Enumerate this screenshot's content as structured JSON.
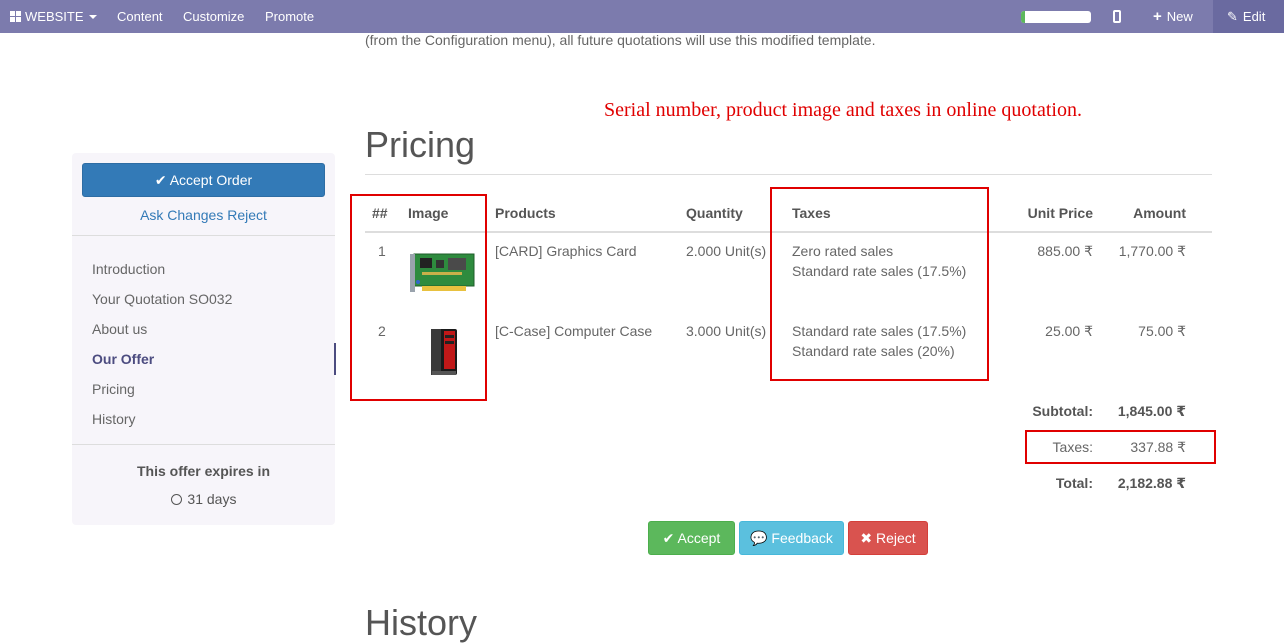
{
  "topbar": {
    "website": "WEBSITE",
    "content": "Content",
    "customize": "Customize",
    "promote": "Promote",
    "new": "New",
    "edit": "Edit"
  },
  "intro_text": "(from the Configuration menu), all future quotations will use this modified template.",
  "annotation": "Serial number, product image and taxes in online quotation.",
  "sidebar": {
    "accept_order": "Accept Order",
    "ask_changes": "Ask Changes",
    "reject": "Reject",
    "nav": [
      "Introduction",
      "Your Quotation SO032",
      "About us",
      "Our Offer",
      "Pricing",
      "History"
    ],
    "expires_title": "This offer expires in",
    "expires_days": "31 days"
  },
  "pricing": {
    "heading": "Pricing",
    "headers": {
      "serial": "##",
      "image": "Image",
      "products": "Products",
      "quantity": "Quantity",
      "taxes": "Taxes",
      "unit_price": "Unit Price",
      "amount": "Amount"
    },
    "rows": [
      {
        "serial": "1",
        "product": "[CARD] Graphics Card",
        "quantity": "2.000 Unit(s)",
        "tax1": "Zero rated sales",
        "tax2": "Standard rate sales (17.5%)",
        "unit_price": "885.00 ₹",
        "amount": "1,770.00 ₹"
      },
      {
        "serial": "2",
        "product": "[C-Case] Computer Case",
        "quantity": "3.000 Unit(s)",
        "tax1": "Standard rate sales (17.5%)",
        "tax2": "Standard rate sales (20%)",
        "unit_price": "25.00 ₹",
        "amount": "75.00 ₹"
      }
    ],
    "subtotal_label": "Subtotal:",
    "subtotal_value": "1,845.00 ₹",
    "taxes_label": "Taxes:",
    "taxes_value": "337.88 ₹",
    "total_label": "Total:",
    "total_value": "2,182.88 ₹"
  },
  "actions": {
    "accept": "Accept",
    "feedback": "Feedback",
    "reject": "Reject"
  },
  "history_heading": "History",
  "colors": {
    "topbar": "#7c7bad",
    "primary": "#337ab7",
    "success": "#5cb85c",
    "info": "#5bc0de",
    "danger": "#d9534f",
    "annotation": "#e00000"
  }
}
